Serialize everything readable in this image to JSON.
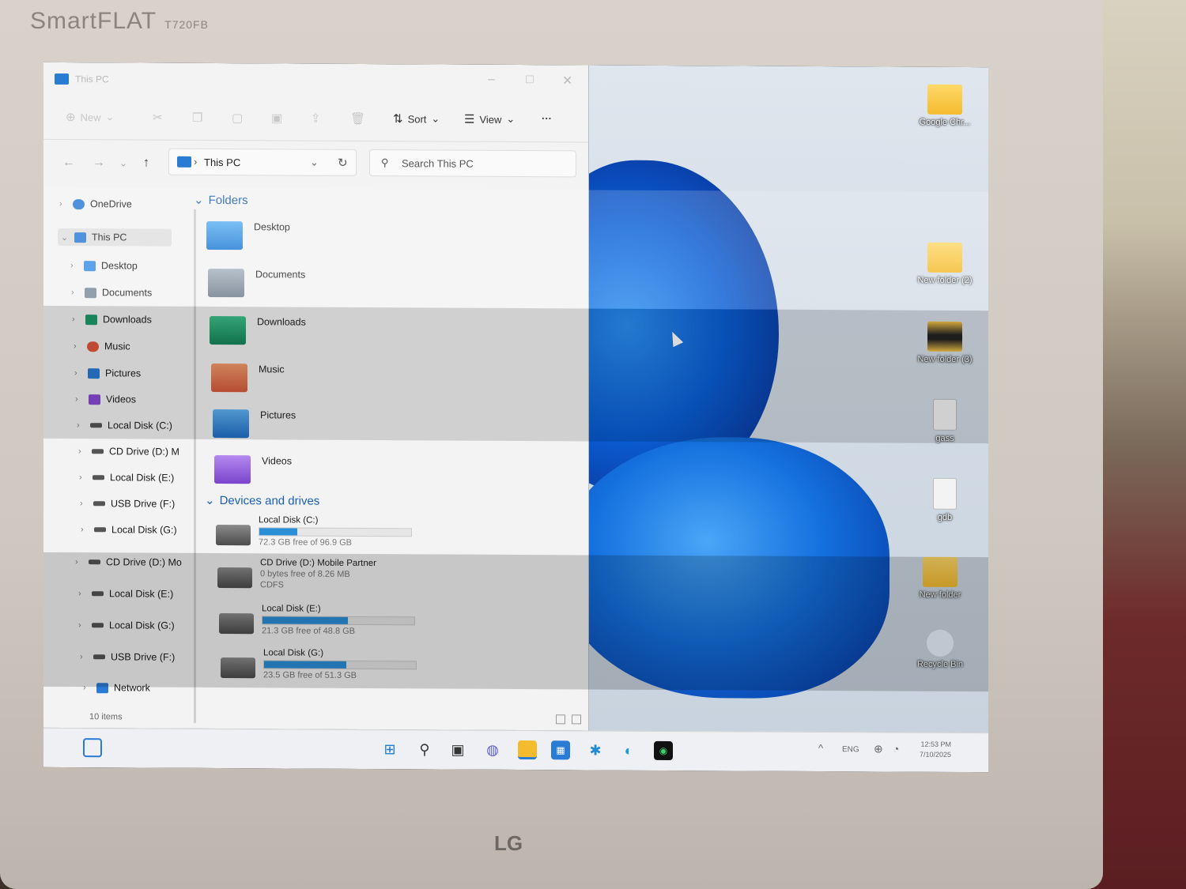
{
  "monitor": {
    "brand": "SmartFLAT",
    "model": "T720FB",
    "logo": "LG"
  },
  "window": {
    "title": "This PC"
  },
  "toolbar": {
    "new_label": "New",
    "sort_label": "Sort",
    "view_label": "View",
    "more_label": "···"
  },
  "address": {
    "path": "This PC",
    "search_placeholder": "Search This PC"
  },
  "nav_pane": {
    "items": [
      {
        "label": "OneDrive",
        "icon": "cloud-icon",
        "color": "#2a7bd4"
      },
      {
        "label": "This PC",
        "icon": "pc-icon",
        "color": "#2a7bd4"
      },
      {
        "label": "Desktop",
        "icon": "desktop-icon",
        "color": "#3a8ee6"
      },
      {
        "label": "Documents",
        "icon": "documents-icon",
        "color": "#7a8a9a"
      },
      {
        "label": "Downloads",
        "icon": "downloads-icon",
        "color": "#1e9a6a"
      },
      {
        "label": "Music",
        "icon": "music-icon",
        "color": "#e0553a"
      },
      {
        "label": "Pictures",
        "icon": "pictures-icon",
        "color": "#2a7bd4"
      },
      {
        "label": "Videos",
        "icon": "videos-icon",
        "color": "#8a4ad4"
      },
      {
        "label": "Local Disk (C:)",
        "icon": "drive-icon",
        "color": "#555555"
      },
      {
        "label": "CD Drive (D:) M",
        "icon": "cd-drive-icon",
        "color": "#555555"
      },
      {
        "label": "Local Disk (E:)",
        "icon": "drive-icon",
        "color": "#555555"
      },
      {
        "label": "USB Drive (F:)",
        "icon": "usb-drive-icon",
        "color": "#555555"
      },
      {
        "label": "Local Disk (G:)",
        "icon": "drive-icon",
        "color": "#555555"
      },
      {
        "label": "CD Drive (D:) Mo",
        "icon": "cd-drive-icon",
        "color": "#555555"
      },
      {
        "label": "Local Disk (E:)",
        "icon": "drive-icon",
        "color": "#555555"
      },
      {
        "label": "Local Disk (G:)",
        "icon": "drive-icon",
        "color": "#555555"
      },
      {
        "label": "USB Drive (F:)",
        "icon": "usb-drive-icon",
        "color": "#555555"
      },
      {
        "label": "Network",
        "icon": "network-icon",
        "color": "#2a7bd4"
      }
    ]
  },
  "content": {
    "folders_header": "Folders",
    "folders": [
      {
        "label": "Desktop",
        "icon": "desktop-folder-icon",
        "color": "#2f8fe0"
      },
      {
        "label": "Documents",
        "icon": "documents-folder-icon",
        "color": "#8795a3"
      },
      {
        "label": "Downloads",
        "icon": "downloads-folder-icon",
        "color": "#1f9c6b"
      },
      {
        "label": "Music",
        "icon": "music-folder-icon",
        "color": "#e06a45"
      },
      {
        "label": "Pictures",
        "icon": "pictures-folder-icon",
        "color": "#2e86d8"
      },
      {
        "label": "Videos",
        "icon": "videos-folder-icon",
        "color": "#8e57d6"
      }
    ],
    "drives_header": "Devices and drives",
    "drives": [
      {
        "label": "Local Disk (C:)",
        "detail": "72.3 GB free of 96.9 GB",
        "used_fraction": 0.25,
        "icon": "windows-drive-icon"
      },
      {
        "label": "CD Drive (D:) Mobile Partner",
        "detail": "0 bytes free of 8.26 MB",
        "detail2": "CDFS",
        "icon": "cd-drive-icon"
      },
      {
        "label": "Local Disk (E:)",
        "detail": "21.3 GB free of 48.8 GB",
        "used_fraction": 0.56,
        "icon": "drive-icon"
      },
      {
        "label": "Local Disk (G:)",
        "detail": "23.5 GB free of 51.3 GB",
        "used_fraction": 0.54,
        "icon": "drive-icon"
      }
    ]
  },
  "status": {
    "items_count": "10 items"
  },
  "desktop": {
    "icons": [
      {
        "label": "Google Chr...",
        "icon": "folder-icon"
      },
      {
        "label": "New folder (2)",
        "icon": "folder-icon"
      },
      {
        "label": "New folder (3)",
        "icon": "folder-icon"
      },
      {
        "label": "gass",
        "icon": "file-icon"
      },
      {
        "label": "gdb",
        "icon": "file-icon"
      },
      {
        "label": "New folder",
        "icon": "folder-icon"
      },
      {
        "label": "Recycle Bin",
        "icon": "recycle-bin-icon"
      }
    ]
  },
  "taskbar": {
    "apps": [
      "widgets-icon",
      "start-icon",
      "search-icon",
      "task-view-icon",
      "chat-icon",
      "file-explorer-icon",
      "store-icon",
      "asterisk-app-icon",
      "edge-icon",
      "xbox-icon"
    ],
    "tray": {
      "chevron": "^",
      "language": "ENG"
    },
    "time": "12:53 PM",
    "date": "7/10/2025"
  }
}
